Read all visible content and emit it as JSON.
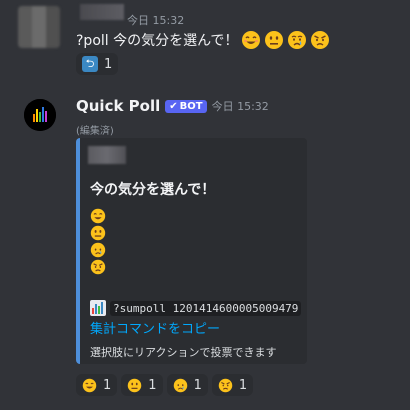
{
  "message1": {
    "timestamp": "今日 15:32",
    "text": "?poll 今の気分を選んで！",
    "emojis": [
      "smiling-face",
      "neutral-face",
      "crying-face",
      "angry-face"
    ],
    "reaction": {
      "icon": "repeat-icon",
      "count": "1"
    }
  },
  "message2": {
    "author": "Quick Poll",
    "badge": "BOT",
    "timestamp": "今日 15:32",
    "edited": "(編集済)",
    "embed": {
      "title": "今の気分を選んで！",
      "options": [
        "smiling-face",
        "neutral-face",
        "crying-face",
        "angry-face"
      ],
      "command": "?sumpoll 1201414600005009479",
      "link": "集計コマンドをコピー",
      "footer": "選択肢にリアクションで投票できます",
      "accent_color": "#4e8fda"
    },
    "reactions": [
      {
        "icon": "smiling-face",
        "count": "1"
      },
      {
        "icon": "neutral-face",
        "count": "1"
      },
      {
        "icon": "crying-face",
        "count": "1"
      },
      {
        "icon": "angry-face",
        "count": "1"
      }
    ]
  },
  "colors": {
    "background": "#313338",
    "embed_background": "#2b2d31",
    "bot_badge": "#5865f2",
    "link": "#00a8fc"
  }
}
